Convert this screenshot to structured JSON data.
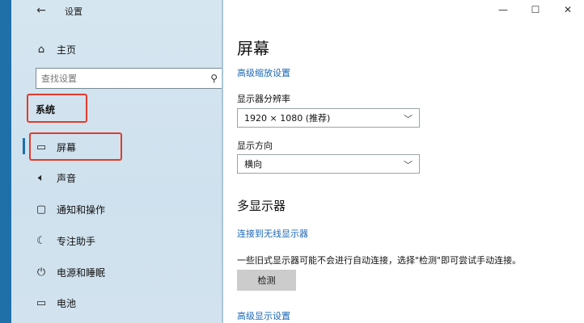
{
  "window": {
    "title": "设置",
    "controls": {
      "minimize": "—",
      "maximize": "☐",
      "close": "✕"
    }
  },
  "sidebar": {
    "back_icon": "arrow-left-icon",
    "home": {
      "label": "主页",
      "icon": "home-icon"
    },
    "search": {
      "placeholder": "查找设置"
    },
    "section": "系统",
    "items": [
      {
        "label": "屏幕",
        "icon": "monitor-icon",
        "active": true
      },
      {
        "label": "声音",
        "icon": "speaker-icon"
      },
      {
        "label": "通知和操作",
        "icon": "notification-icon"
      },
      {
        "label": "专注助手",
        "icon": "moon-icon"
      },
      {
        "label": "电源和睡眠",
        "icon": "power-icon"
      },
      {
        "label": "电池",
        "icon": "battery-icon"
      }
    ]
  },
  "main": {
    "title": "屏幕",
    "advanced_scale_link": "高级缩放设置",
    "resolution": {
      "label": "显示器分辨率",
      "value": "1920 × 1080 (推荐)"
    },
    "orientation": {
      "label": "显示方向",
      "value": "横向"
    },
    "multi_display": {
      "heading": "多显示器",
      "wireless_link": "连接到无线显示器",
      "description": "一些旧式显示器可能不会进行自动连接，选择\"检测\"即可尝试手动连接。",
      "detect_button": "检测"
    },
    "advanced_display_link": "高级显示设置"
  },
  "colors": {
    "accent": "#1f6fa8",
    "link": "#1a67b8",
    "highlight_box": "#e23b2b",
    "sidebar_bg": "#d6e6f1"
  }
}
